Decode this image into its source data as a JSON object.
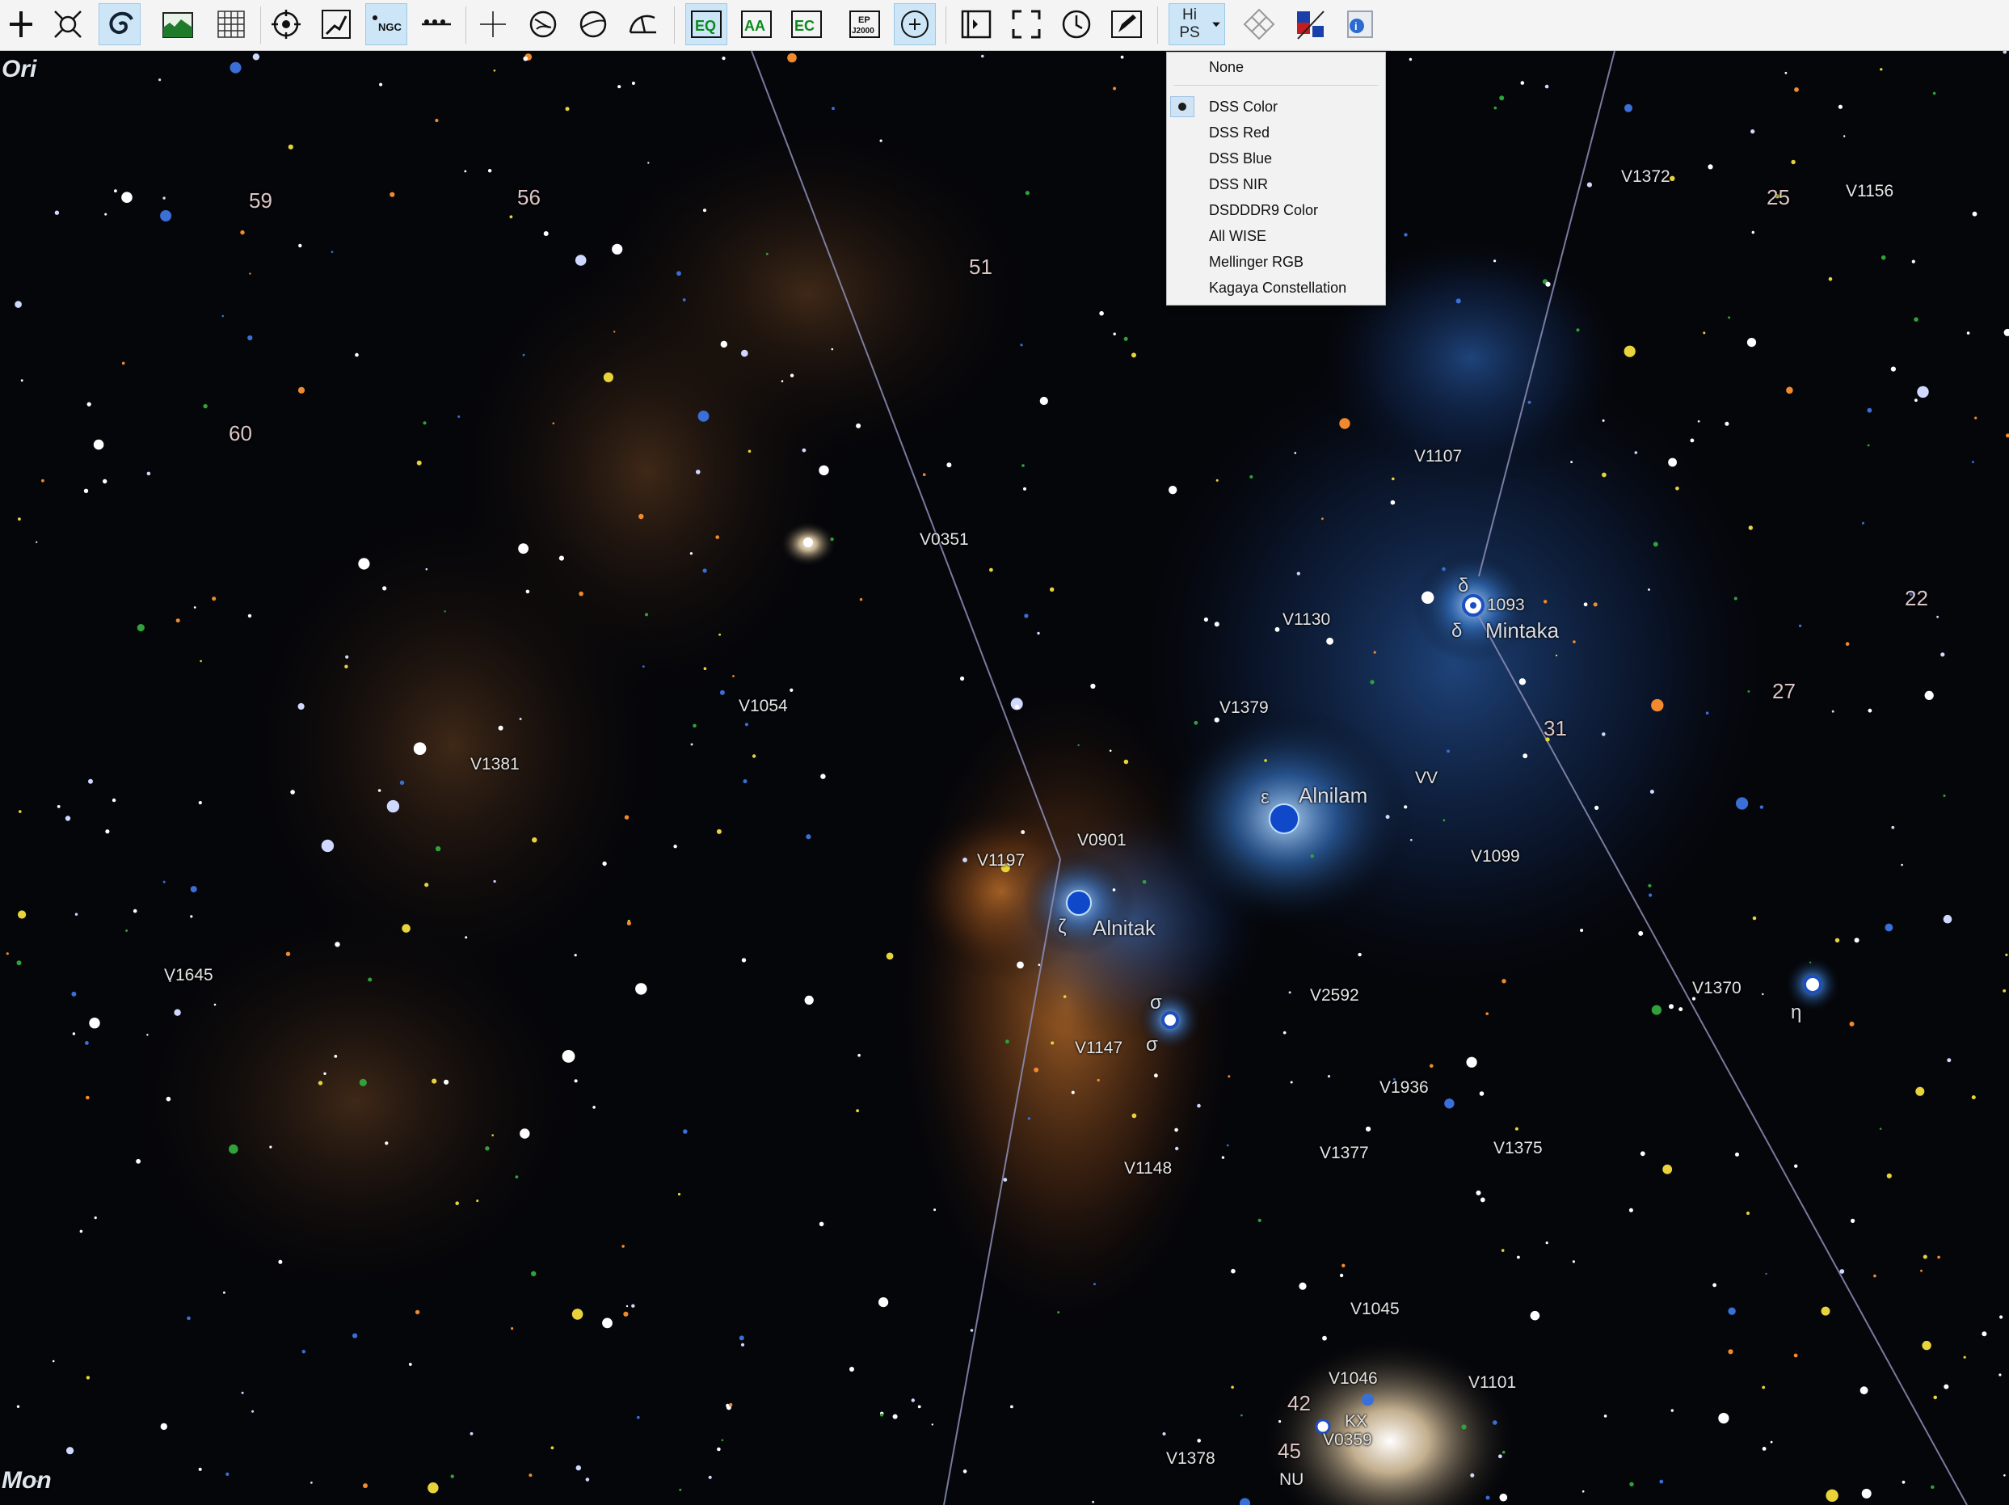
{
  "toolbar": {
    "hips_label_top": "Hi",
    "hips_label_bottom": "PS",
    "eq_label": "EQ",
    "aa_label": "AA",
    "ec_label": "EC",
    "epoch_top": "EP",
    "epoch_bottom": "J2000",
    "ngc_label": "NGC",
    "active_buttons": [
      "galaxy",
      "ngc-labels",
      "hips"
    ]
  },
  "sky": {
    "constellation_top": "Ori",
    "constellation_bottom": "Mon",
    "star_names": {
      "mintaka": "Mintaka",
      "alnilam": "Alnilam",
      "alnitak": "Alnitak"
    },
    "flamsteed": {
      "n59": "59",
      "n56": "56",
      "n51": "51",
      "n60": "60",
      "n25": "25",
      "n22": "22",
      "n27": "27",
      "n31": "31",
      "n42": "42",
      "n45": "45"
    },
    "greek": {
      "delta1": "δ",
      "delta2": "δ",
      "epsilon": "ε",
      "zeta": "ζ",
      "sigma1": "σ",
      "sigma2": "σ",
      "eta": "η"
    },
    "variables": {
      "v1372": "V1372",
      "v1156": "V1156",
      "v1107": "V1107",
      "v0351": "V0351",
      "v1093": "1093",
      "v1130": "V1130",
      "v1054": "V1054",
      "v1379": "V1379",
      "v1381": "V1381",
      "vv": "VV",
      "v0901": "V0901",
      "v1099": "V1099",
      "v1197": "V1197",
      "v1645": "V1645",
      "v2592": "V2592",
      "v1370": "V1370",
      "v1147": "V1147",
      "v1936": "V1936",
      "v1377": "V1377",
      "v1375": "V1375",
      "v1148": "V1148",
      "v1045": "V1045",
      "v1046": "V1046",
      "v1101": "V1101",
      "kx": "KX",
      "v0359": "V0359",
      "v1378": "V1378",
      "nu": "NU"
    }
  },
  "hips_menu": {
    "items": [
      "None",
      "DSS Color",
      "DSS Red",
      "DSS Blue",
      "DSS NIR",
      "DSDDDR9 Color",
      "All WISE",
      "Mellinger RGB",
      "Kagaya Constellation"
    ],
    "selected": "DSS Color"
  },
  "colors": {
    "toolbar_bg": "#f4f4f4",
    "active_button_bg": "#cde6f7",
    "sky_bg": "#05060a",
    "nebula_orange": "#b86a2a",
    "nebula_blue": "#1f4f9a",
    "boundary_line": "#8d8fb8"
  }
}
